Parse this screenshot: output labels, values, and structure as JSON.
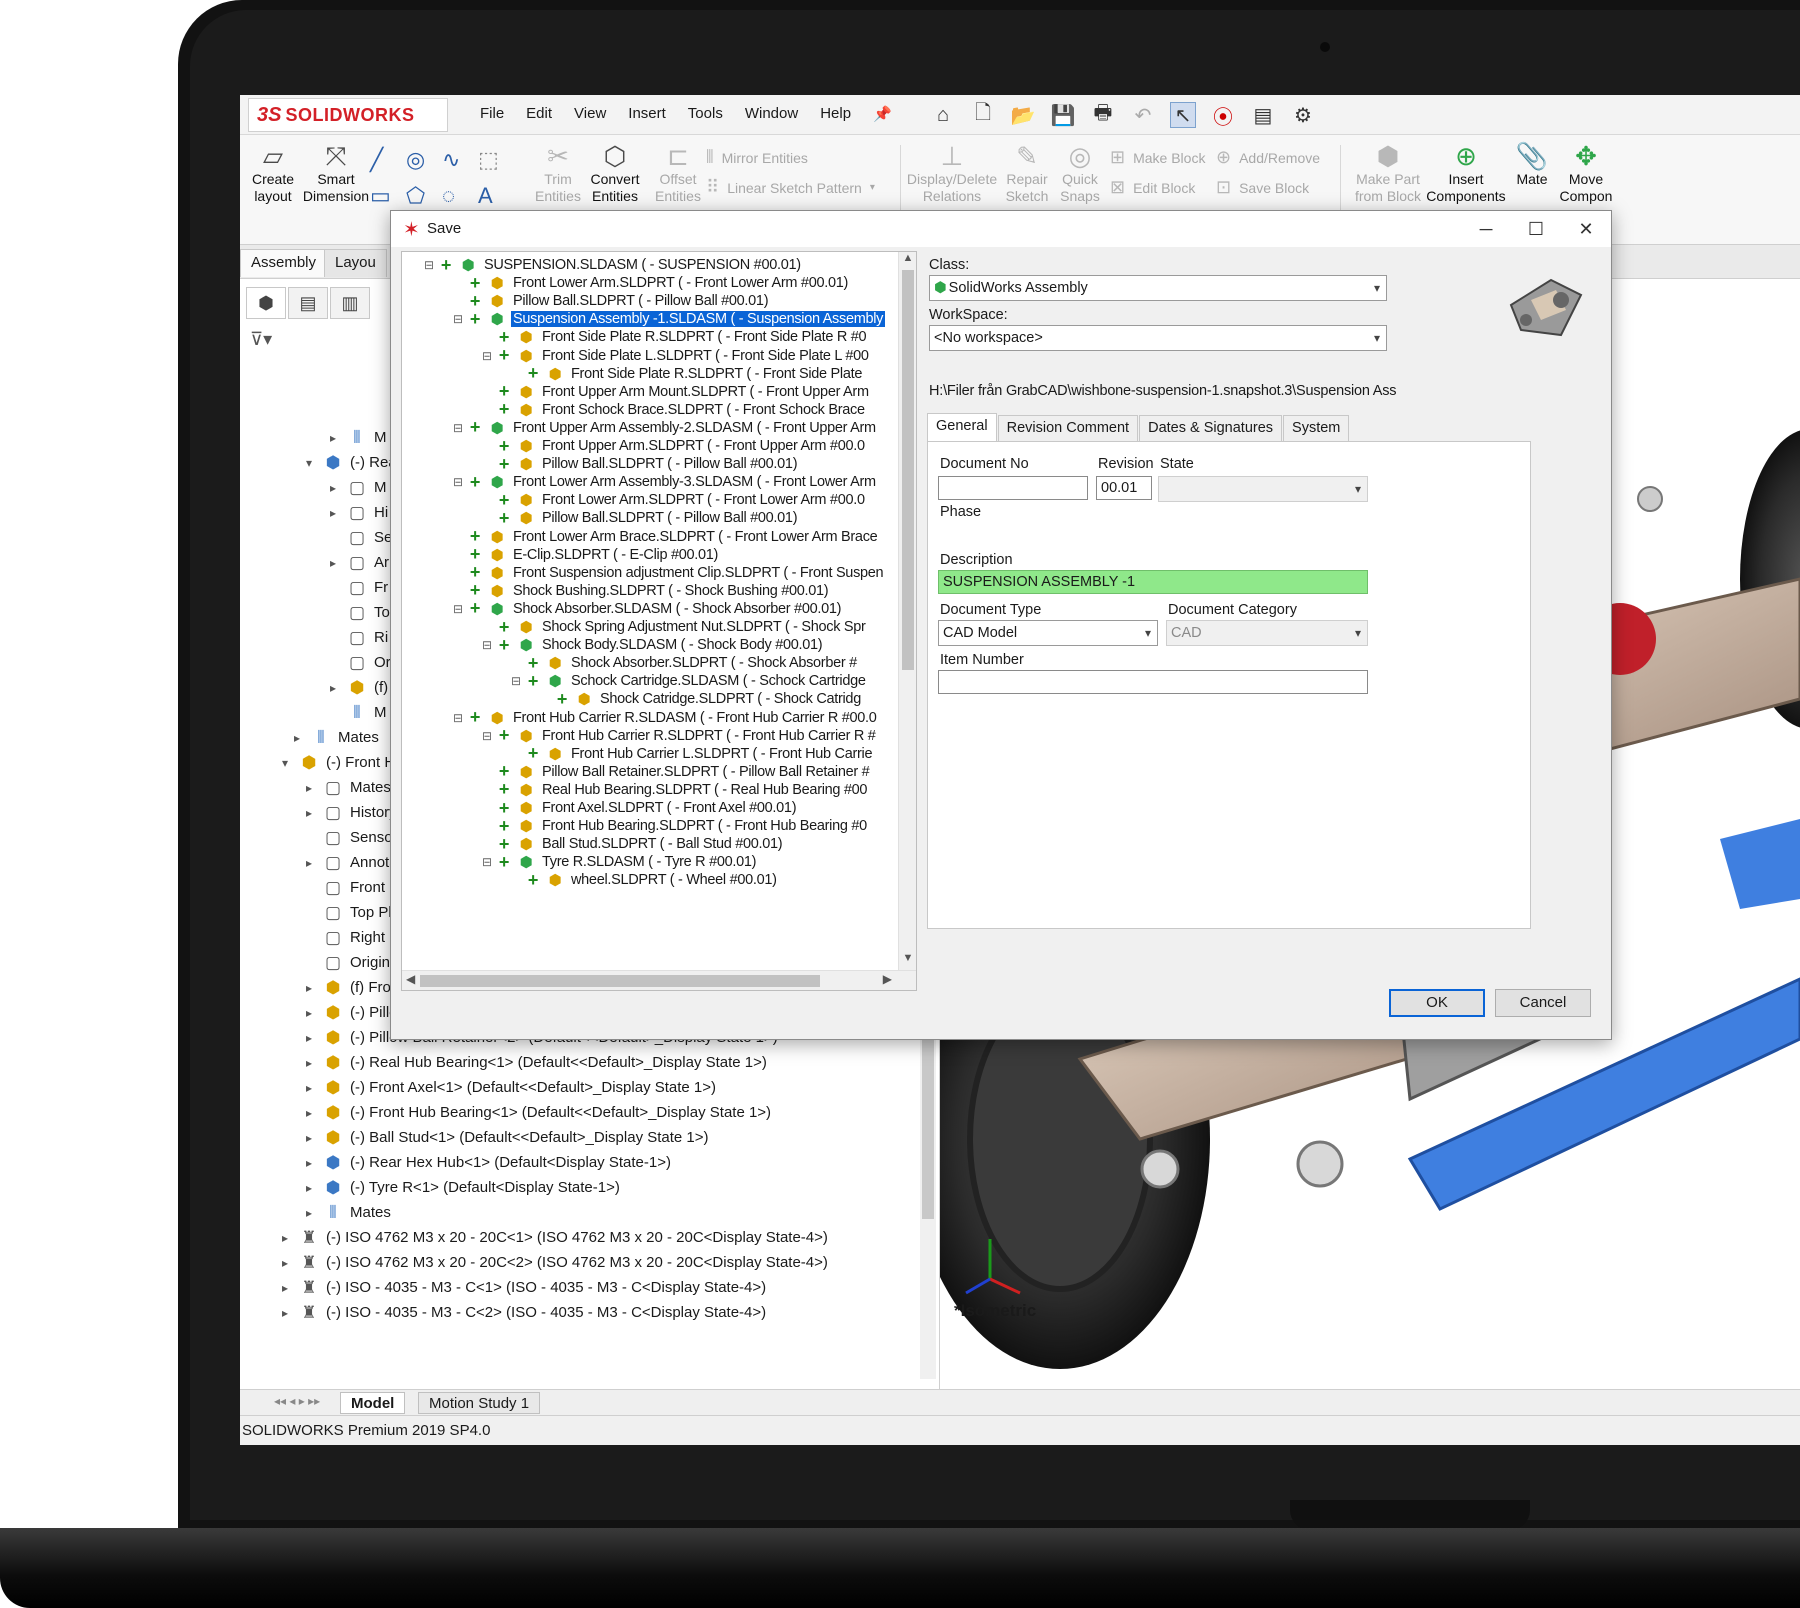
{
  "app": {
    "logo_prefix": "3S",
    "logo_text": "SOLIDWORKS",
    "menu": [
      "File",
      "Edit",
      "View",
      "Insert",
      "Tools",
      "Window",
      "Help"
    ],
    "status_text": "SOLIDWORKS Premium 2019 SP4.0",
    "accent_color": "#d32027"
  },
  "ribbon": {
    "create_layout": "Create layout",
    "smart_dimension": "Smart Dimension",
    "trim_entities": "Trim Entities",
    "convert_entities": "Convert Entities",
    "offset_entities": "Offset Entities",
    "mirror_entities": "Mirror Entities",
    "linear_sketch_pattern": "Linear Sketch Pattern",
    "display_delete_relations": "Display/Delete Relations",
    "repair_sketch": "Repair Sketch",
    "quick_snaps": "Quick Snaps",
    "make_block": "Make Block",
    "edit_block": "Edit Block",
    "add_remove": "Add/Remove",
    "save_block": "Save Block",
    "make_part_from_block": "Make Part from Block",
    "insert_components": "Insert Components",
    "mate": "Mate",
    "move_component": "Move Compon"
  },
  "command_tabs": [
    "Assembly",
    "Layou"
  ],
  "feature_tree": [
    {
      "indent": 1,
      "icon": "mate",
      "text": "M",
      "exp": "▸"
    },
    {
      "indent": 0,
      "icon": "sub",
      "text": "(-) Rea",
      "exp": "▾"
    },
    {
      "indent": 1,
      "icon": "plain",
      "text": "M",
      "exp": "▸"
    },
    {
      "indent": 1,
      "icon": "plain",
      "text": "Hi",
      "exp": "▸"
    },
    {
      "indent": 1,
      "icon": "plain",
      "text": "Se",
      "exp": ""
    },
    {
      "indent": 1,
      "icon": "plain",
      "text": "Ar",
      "exp": "▸"
    },
    {
      "indent": 1,
      "icon": "plain",
      "text": "Fr",
      "exp": ""
    },
    {
      "indent": 1,
      "icon": "plain",
      "text": "To",
      "exp": ""
    },
    {
      "indent": 1,
      "icon": "plain",
      "text": "Ri",
      "exp": ""
    },
    {
      "indent": 1,
      "icon": "plain",
      "text": "Or",
      "exp": ""
    },
    {
      "indent": 1,
      "icon": "part",
      "text": "(f)",
      "exp": "▸"
    },
    {
      "indent": 1,
      "icon": "mate",
      "text": "M",
      "exp": ""
    },
    {
      "indent": -0.5,
      "icon": "mate",
      "text": "Mates",
      "exp": "▸"
    },
    {
      "indent": -1,
      "icon": "asm",
      "text": "(-) Front H",
      "exp": "▾"
    },
    {
      "indent": 0,
      "icon": "plain",
      "text": "Mates",
      "exp": "▸"
    },
    {
      "indent": 0,
      "icon": "plain",
      "text": "History",
      "exp": "▸"
    },
    {
      "indent": 0,
      "icon": "plain",
      "text": "Sensor",
      "exp": ""
    },
    {
      "indent": 0,
      "icon": "plain",
      "text": "Annota",
      "exp": "▸"
    },
    {
      "indent": 0,
      "icon": "plain",
      "text": "Front P",
      "exp": ""
    },
    {
      "indent": 0,
      "icon": "plain",
      "text": "Top Pla",
      "exp": ""
    },
    {
      "indent": 0,
      "icon": "plain",
      "text": "Right P",
      "exp": ""
    },
    {
      "indent": 0,
      "icon": "plain",
      "text": "Origin",
      "exp": ""
    },
    {
      "indent": 0,
      "icon": "part",
      "text": "(f) Fron",
      "exp": "▸"
    },
    {
      "indent": 0,
      "icon": "part",
      "text": "(-) Pillow Ball Retainer<1> (Default<<Default>_Display State 1>)",
      "exp": "▸"
    },
    {
      "indent": 0,
      "icon": "part",
      "text": "(-) Pillow Ball Retainer<2> (Default<<Default>_Display State 1>)",
      "exp": "▸"
    },
    {
      "indent": 0,
      "icon": "part",
      "text": "(-) Real Hub Bearing<1> (Default<<Default>_Display State 1>)",
      "exp": "▸"
    },
    {
      "indent": 0,
      "icon": "part",
      "text": "(-) Front Axel<1> (Default<<Default>_Display State 1>)",
      "exp": "▸"
    },
    {
      "indent": 0,
      "icon": "part",
      "text": "(-) Front Hub Bearing<1> (Default<<Default>_Display State 1>)",
      "exp": "▸"
    },
    {
      "indent": 0,
      "icon": "part",
      "text": "(-) Ball Stud<1> (Default<<Default>_Display State 1>)",
      "exp": "▸"
    },
    {
      "indent": 0,
      "icon": "sub",
      "text": "(-) Rear Hex Hub<1> (Default<Display State-1>)",
      "exp": "▸"
    },
    {
      "indent": 0,
      "icon": "sub",
      "text": "(-) Tyre R<1> (Default<Display State-1>)",
      "exp": "▸"
    },
    {
      "indent": 0,
      "icon": "mate",
      "text": "Mates",
      "exp": "▸"
    },
    {
      "indent": -1,
      "icon": "screw",
      "text": "(-) ISO 4762 M3 x 20 - 20C<1> (ISO 4762 M3 x 20 - 20C<Display State-4>)",
      "exp": "▸"
    },
    {
      "indent": -1,
      "icon": "screw",
      "text": "(-) ISO 4762 M3 x 20 - 20C<2> (ISO 4762 M3 x 20 - 20C<Display State-4>)",
      "exp": "▸"
    },
    {
      "indent": -1,
      "icon": "screw",
      "text": "(-) ISO - 4035 - M3 - C<1> (ISO - 4035 - M3 - C<Display State-4>)",
      "exp": "▸"
    },
    {
      "indent": -1,
      "icon": "screw",
      "text": "(-) ISO - 4035 - M3 - C<2> (ISO - 4035 - M3 - C<Display State-4>)",
      "exp": "▸"
    }
  ],
  "bottom_tabs": [
    "Model",
    "Motion Study 1"
  ],
  "viewport": {
    "view_label": "*Isometric"
  },
  "dialog": {
    "title": "Save",
    "tree": [
      {
        "level": 0,
        "toggle": "⊟",
        "icon": "asm",
        "text": "SUSPENSION.SLDASM (  - SUSPENSION #00.01)"
      },
      {
        "level": 1,
        "toggle": "",
        "icon": "part",
        "text": "Front Lower Arm.SLDPRT (  - Front Lower Arm #00.01)"
      },
      {
        "level": 1,
        "toggle": "",
        "icon": "part",
        "text": "Pillow Ball.SLDPRT (  - Pillow Ball #00.01)"
      },
      {
        "level": 1,
        "toggle": "⊟",
        "icon": "asm",
        "text": "Suspension Assembly -1.SLDASM (  - Suspension Assembly",
        "selected": true
      },
      {
        "level": 2,
        "toggle": "",
        "icon": "part",
        "text": "Front Side Plate R.SLDPRT (  - Front Side Plate R #0"
      },
      {
        "level": 2,
        "toggle": "⊟",
        "icon": "part",
        "text": "Front Side Plate L.SLDPRT (  - Front Side Plate L #00"
      },
      {
        "level": 3,
        "toggle": "",
        "icon": "part",
        "text": "Front Side Plate R.SLDPRT (  - Front Side Plate"
      },
      {
        "level": 2,
        "toggle": "",
        "icon": "part",
        "text": "Front Upper Arm Mount.SLDPRT (  - Front Upper Arm"
      },
      {
        "level": 2,
        "toggle": "",
        "icon": "part",
        "text": "Front Schock Brace.SLDPRT (  - Front Schock Brace"
      },
      {
        "level": 1,
        "toggle": "⊟",
        "icon": "asm",
        "text": "Front Upper Arm Assembly-2.SLDASM (  - Front Upper Arm"
      },
      {
        "level": 2,
        "toggle": "",
        "icon": "part",
        "text": "Front Upper Arm.SLDPRT (  - Front Upper Arm #00.0"
      },
      {
        "level": 2,
        "toggle": "",
        "icon": "part",
        "text": "Pillow Ball.SLDPRT (  - Pillow Ball #00.01)"
      },
      {
        "level": 1,
        "toggle": "⊟",
        "icon": "asm",
        "text": "Front Lower Arm Assembly-3.SLDASM (  - Front Lower Arm"
      },
      {
        "level": 2,
        "toggle": "",
        "icon": "part",
        "text": "Front Lower Arm.SLDPRT (  - Front Lower Arm #00.0"
      },
      {
        "level": 2,
        "toggle": "",
        "icon": "part",
        "text": "Pillow Ball.SLDPRT (  - Pillow Ball #00.01)"
      },
      {
        "level": 1,
        "toggle": "",
        "icon": "part",
        "text": "Front Lower Arm Brace.SLDPRT (  - Front Lower Arm Brace"
      },
      {
        "level": 1,
        "toggle": "",
        "icon": "part",
        "text": "E-Clip.SLDPRT (  - E-Clip #00.01)"
      },
      {
        "level": 1,
        "toggle": "",
        "icon": "part",
        "text": "Front Suspension adjustment Clip.SLDPRT (  - Front Suspen"
      },
      {
        "level": 1,
        "toggle": "",
        "icon": "part",
        "text": "Shock Bushing.SLDPRT (  - Shock Bushing #00.01)"
      },
      {
        "level": 1,
        "toggle": "⊟",
        "icon": "asm",
        "text": "Shock Absorber.SLDASM (  - Shock Absorber #00.01)"
      },
      {
        "level": 2,
        "toggle": "",
        "icon": "part",
        "text": "Shock Spring Adjustment Nut.SLDPRT (  - Shock Spr"
      },
      {
        "level": 2,
        "toggle": "⊟",
        "icon": "asm",
        "text": "Shock Body.SLDASM (  - Shock Body #00.01)"
      },
      {
        "level": 3,
        "toggle": "",
        "icon": "part",
        "text": "Shock Absorber.SLDPRT (  - Shock Absorber #"
      },
      {
        "level": 3,
        "toggle": "⊟",
        "icon": "asm",
        "text": "Schock Cartridge.SLDASM (  - Schock Cartridge"
      },
      {
        "level": 4,
        "toggle": "",
        "icon": "part",
        "text": "Shock Catridge.SLDPRT (  - Shock Catridg"
      },
      {
        "level": 1,
        "toggle": "⊟",
        "icon": "part",
        "text": "Front Hub Carrier R.SLDASM (  - Front Hub Carrier R #00.0"
      },
      {
        "level": 2,
        "toggle": "⊟",
        "icon": "part",
        "text": "Front Hub Carrier R.SLDPRT (  - Front Hub Carrier R #"
      },
      {
        "level": 3,
        "toggle": "",
        "icon": "part",
        "text": "Front Hub Carrier L.SLDPRT (  - Front Hub Carrie"
      },
      {
        "level": 2,
        "toggle": "",
        "icon": "part",
        "text": "Pillow Ball Retainer.SLDPRT (  - Pillow Ball Retainer #"
      },
      {
        "level": 2,
        "toggle": "",
        "icon": "part",
        "text": "Real Hub Bearing.SLDPRT (  - Real Hub Bearing #00"
      },
      {
        "level": 2,
        "toggle": "",
        "icon": "part",
        "text": "Front Axel.SLDPRT (  - Front Axel #00.01)"
      },
      {
        "level": 2,
        "toggle": "",
        "icon": "part",
        "text": "Front Hub Bearing.SLDPRT (  - Front Hub Bearing #0"
      },
      {
        "level": 2,
        "toggle": "",
        "icon": "part",
        "text": "Ball Stud.SLDPRT (  - Ball Stud #00.01)"
      },
      {
        "level": 2,
        "toggle": "⊟",
        "icon": "asm",
        "text": "Tyre R.SLDASM (  - Tyre R #00.01)"
      },
      {
        "level": 3,
        "toggle": "",
        "icon": "part",
        "text": "wheel.SLDPRT (  - Wheel #00.01)"
      }
    ],
    "class_label": "Class:",
    "class_value": "SolidWorks Assembly",
    "workspace_label": "WorkSpace:",
    "workspace_value": "<No workspace>",
    "path": "H:\\Filer från GrabCAD\\wishbone-suspension-1.snapshot.3\\Suspension Ass",
    "tabs": [
      "General",
      "Revision Comment",
      "Dates & Signatures",
      "System"
    ],
    "fields": {
      "document_no_label": "Document No",
      "document_no_value": "",
      "revision_label": "Revision",
      "revision_value": "00.01",
      "state_label": "State",
      "state_value": "",
      "phase_label": "Phase",
      "description_label": "Description",
      "description_value": "SUSPENSION ASSEMBLY -1",
      "document_type_label": "Document Type",
      "document_type_value": "CAD Model",
      "document_category_label": "Document Category",
      "document_category_value": "CAD",
      "item_number_label": "Item Number",
      "item_number_value": ""
    },
    "ok_label": "OK",
    "cancel_label": "Cancel",
    "highlight_color": "#8fe88a",
    "selection_color": "#0a64d6"
  }
}
